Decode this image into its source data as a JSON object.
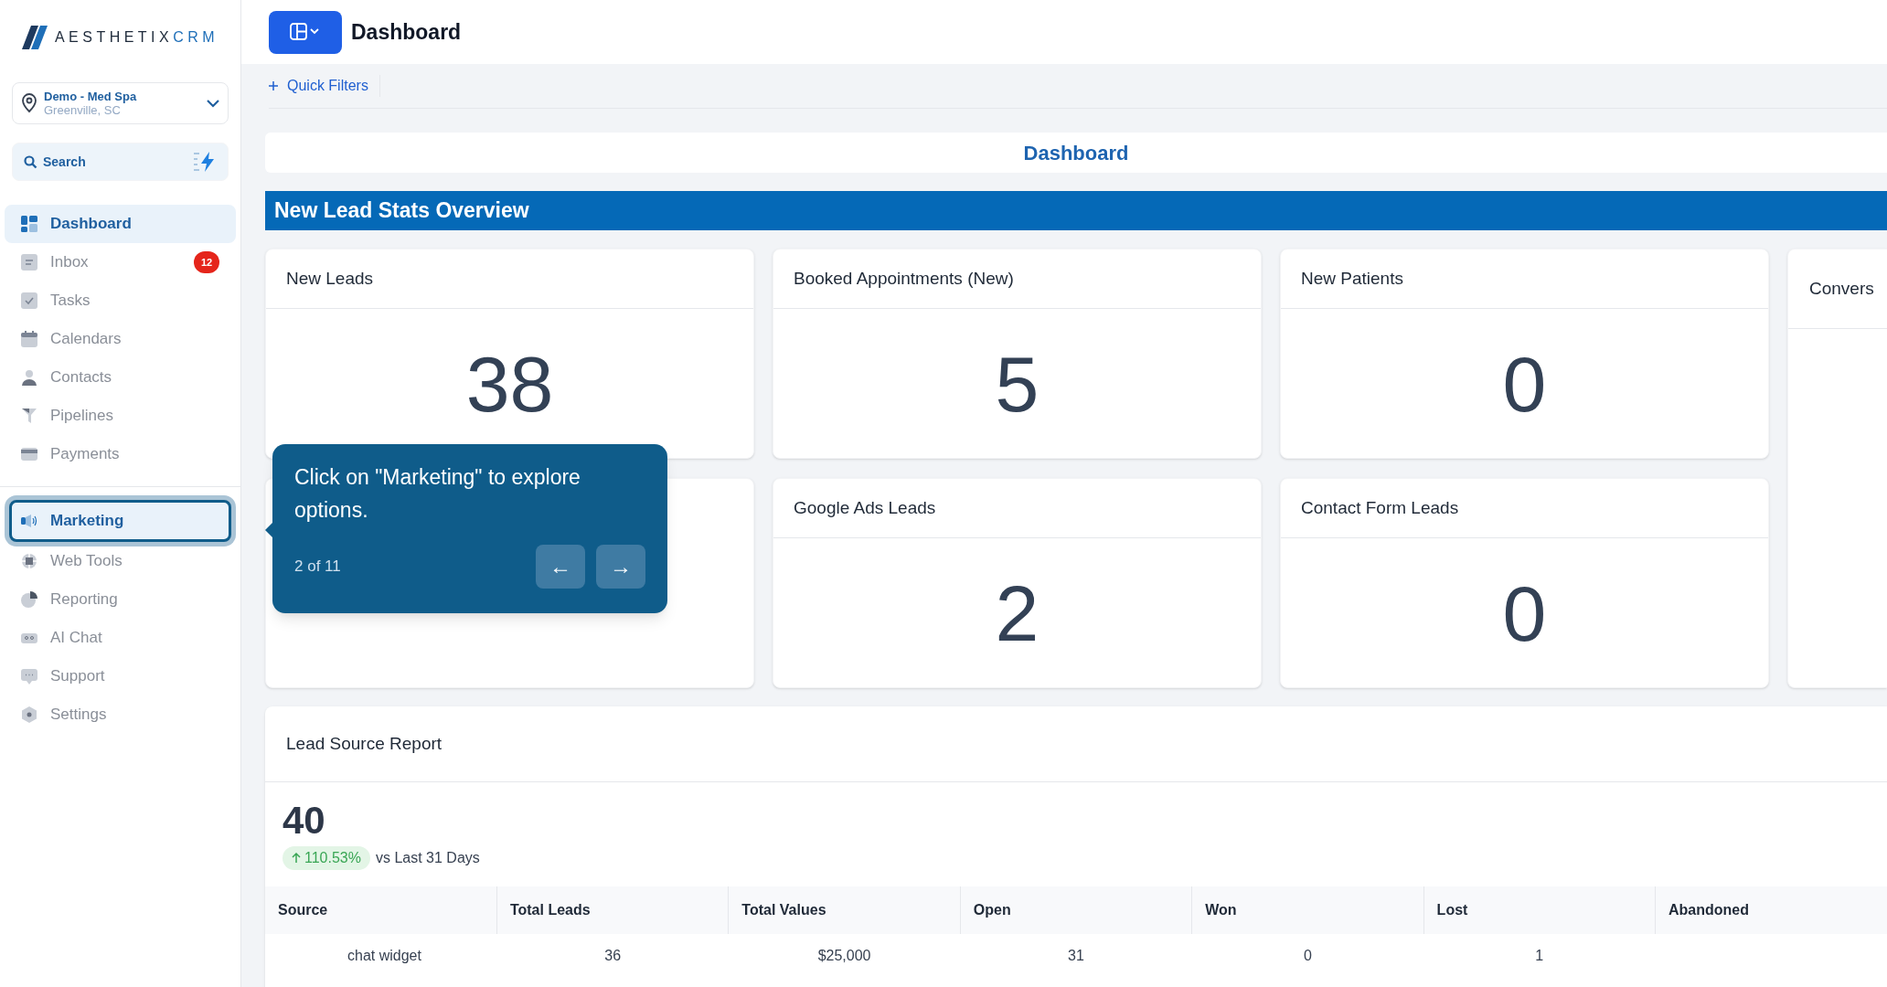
{
  "brand": {
    "name_dark": "AESTHETIX",
    "name_accent": "CRM"
  },
  "location": {
    "name": "Demo - Med Spa",
    "place": "Greenville, SC"
  },
  "search": {
    "placeholder": "Search"
  },
  "sidebar": {
    "groups": [
      {
        "items": [
          {
            "label": "Dashboard",
            "selected": true,
            "highlighted": false
          },
          {
            "label": "Inbox",
            "selected": false,
            "highlighted": false,
            "badge": "12"
          },
          {
            "label": "Tasks",
            "selected": false,
            "highlighted": false
          },
          {
            "label": "Calendars",
            "selected": false,
            "highlighted": false
          },
          {
            "label": "Contacts",
            "selected": false,
            "highlighted": false
          },
          {
            "label": "Pipelines",
            "selected": false,
            "highlighted": false
          },
          {
            "label": "Payments",
            "selected": false,
            "highlighted": false
          }
        ]
      },
      {
        "items": [
          {
            "label": "Marketing",
            "selected": false,
            "highlighted": true
          },
          {
            "label": "Web Tools",
            "selected": false,
            "highlighted": false
          },
          {
            "label": "Reporting",
            "selected": false,
            "highlighted": false
          },
          {
            "label": "AI Chat",
            "selected": false,
            "highlighted": false
          },
          {
            "label": "Support",
            "selected": false,
            "highlighted": false
          },
          {
            "label": "Settings",
            "selected": false,
            "highlighted": false
          }
        ]
      }
    ]
  },
  "header": {
    "title": "Dashboard"
  },
  "filters": {
    "quick_filters": "Quick Filters"
  },
  "dashboard_title": "Dashboard",
  "section_banner": "New Lead Stats Overview",
  "stat_cards": [
    {
      "title": "New Leads",
      "value": "38"
    },
    {
      "title": "Booked Appointments (New)",
      "value": "5"
    },
    {
      "title": "New Patients",
      "value": "0"
    },
    {
      "title": "Google Ads Leads",
      "value": "2"
    },
    {
      "title": "Contact Form Leads",
      "value": "0"
    }
  ],
  "side_card": {
    "title": "Convers"
  },
  "lead_source_report": {
    "title": "Lead Source Report",
    "total": "40",
    "change": "110.53%",
    "change_up": true,
    "comparison": "vs Last 31 Days",
    "columns": [
      "Source",
      "Total Leads",
      "Total Values",
      "Open",
      "Won",
      "Lost",
      "Abandoned"
    ],
    "rows": [
      [
        "chat widget",
        "36",
        "$25,000",
        "31",
        "0",
        "1"
      ]
    ]
  },
  "tour_tooltip": {
    "text": "Click on \"Marketing\" to explore options.",
    "step": "2 of 11",
    "prev": "←",
    "next": "→"
  }
}
